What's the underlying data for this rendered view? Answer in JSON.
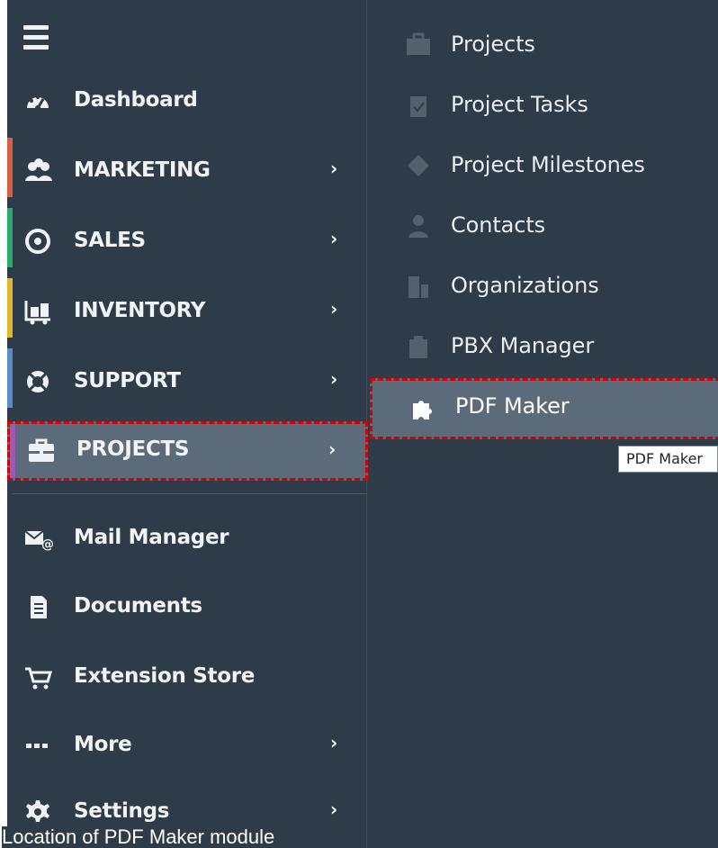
{
  "sidebar": {
    "items": [
      {
        "label": "Dashboard",
        "icon": "dashboard-icon"
      },
      {
        "label": "MARKETING",
        "icon": "marketing-icon",
        "accent": "#d75f3d"
      },
      {
        "label": "SALES",
        "icon": "sales-icon",
        "accent": "#2ea86b"
      },
      {
        "label": "INVENTORY",
        "icon": "inventory-icon",
        "accent": "#e2b72d"
      },
      {
        "label": "SUPPORT",
        "icon": "support-icon",
        "accent": "#5d8bc7"
      },
      {
        "label": "PROJECTS",
        "icon": "briefcase-icon",
        "accent": "#9b59b6"
      },
      {
        "label": "Mail Manager",
        "icon": "mail-icon"
      },
      {
        "label": "Documents",
        "icon": "documents-icon"
      },
      {
        "label": "Extension Store",
        "icon": "cart-icon"
      },
      {
        "label": "More",
        "icon": "more-icon"
      },
      {
        "label": "Settings",
        "icon": "settings-icon"
      }
    ]
  },
  "submenu": {
    "items": [
      {
        "label": "Projects",
        "icon": "briefcase-icon"
      },
      {
        "label": "Project Tasks",
        "icon": "tasks-icon"
      },
      {
        "label": "Project Milestones",
        "icon": "milestone-icon"
      },
      {
        "label": "Contacts",
        "icon": "contacts-icon"
      },
      {
        "label": "Organizations",
        "icon": "organizations-icon"
      },
      {
        "label": "PBX Manager",
        "icon": "pbx-icon"
      },
      {
        "label": "PDF Maker",
        "icon": "puzzle-icon"
      }
    ]
  },
  "tooltip": {
    "text": "PDF Maker"
  },
  "caption": {
    "text": "Location of PDF Maker module"
  },
  "colors": {
    "panel": "#2e3b48",
    "active_bg": "#5c6b79",
    "highlight": "#d50000"
  }
}
